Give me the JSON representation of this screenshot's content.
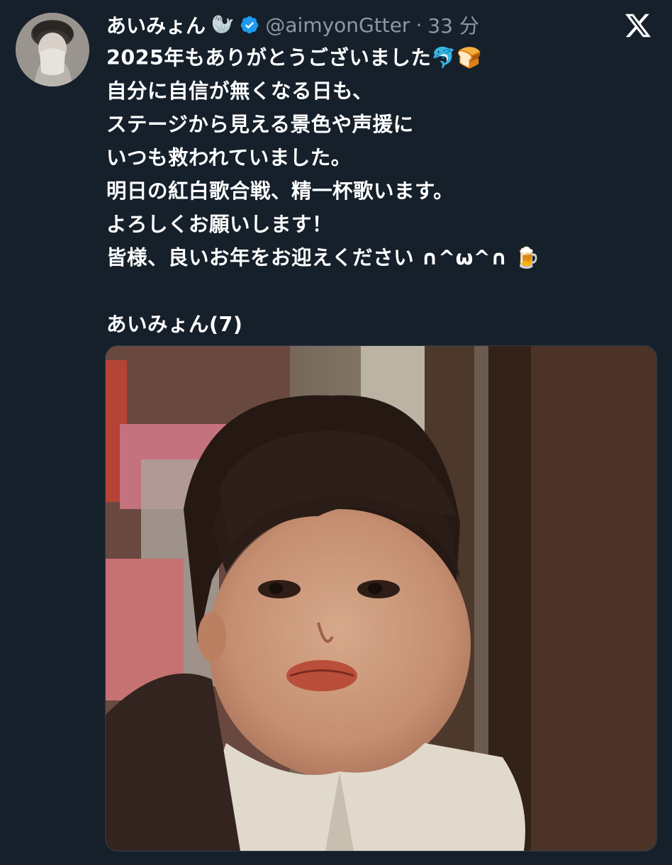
{
  "tweet": {
    "author": {
      "display_name": "あいみょん",
      "name_emoji": "🦭",
      "verified": true,
      "handle": "@aimyonGtter",
      "separator": "·",
      "time": "33 分"
    },
    "text_lines": [
      "2025年もありがとうございました🐬🍞",
      "自分に自信が無くなる日も、",
      "ステージから見える景色や声援に",
      "いつも救われていました。",
      "明日の紅白歌合戦、精一杯歌います。",
      "よろしくお願いします！",
      "皆様、良いお年をお迎えください ∩^ω^∩ 🍺"
    ],
    "signature": "あいみょん(7)",
    "media": {
      "type": "photo",
      "description_icon": "photo-child-portrait"
    }
  },
  "icons": {
    "verified": "verified-badge-icon",
    "platform": "x-logo-icon"
  },
  "colors": {
    "background": "#15202b",
    "secondary_text": "#8b98a5",
    "verified": "#1d9bf0",
    "primary_text": "#ffffff"
  }
}
